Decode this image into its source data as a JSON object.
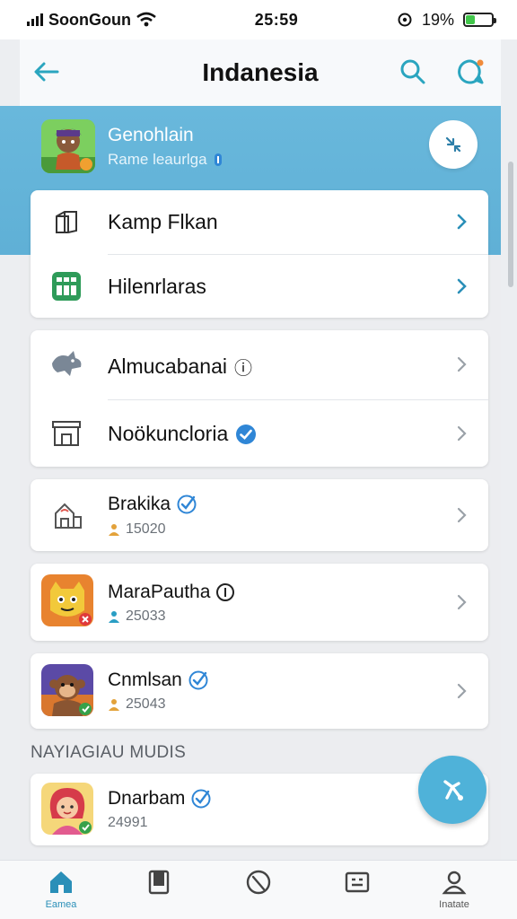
{
  "status": {
    "carrier": "SoonGoun",
    "time": "25:59",
    "battery": "19%"
  },
  "nav": {
    "title": "Indanesia"
  },
  "hero": {
    "name": "Genohlain",
    "subtitle": "Rame leaurlga"
  },
  "menu_group_1": [
    {
      "label": "Kamp Flkan"
    },
    {
      "label": "Hilenrlaras"
    }
  ],
  "menu_group_2": [
    {
      "label": "Almucabanai",
      "badge": "ⓘ"
    },
    {
      "label": "Noökuncloria"
    }
  ],
  "apps": [
    {
      "name": "Brakika",
      "count": "15020"
    },
    {
      "name": "MaraPautha",
      "count": "25033"
    },
    {
      "name": "Cnmlsan",
      "count": "25043"
    }
  ],
  "section": {
    "label": "NAYIAGIAU MUDIS"
  },
  "featured": {
    "name": "Dnarbam",
    "count": "24991"
  },
  "tabs": [
    {
      "label": "Eamea"
    },
    {
      "label": ""
    },
    {
      "label": ""
    },
    {
      "label": ""
    },
    {
      "label": "Inatate"
    }
  ],
  "colors": {
    "accent": "#2aa5bf",
    "hero": "#63b4d9",
    "verified": "#2f86d6"
  }
}
